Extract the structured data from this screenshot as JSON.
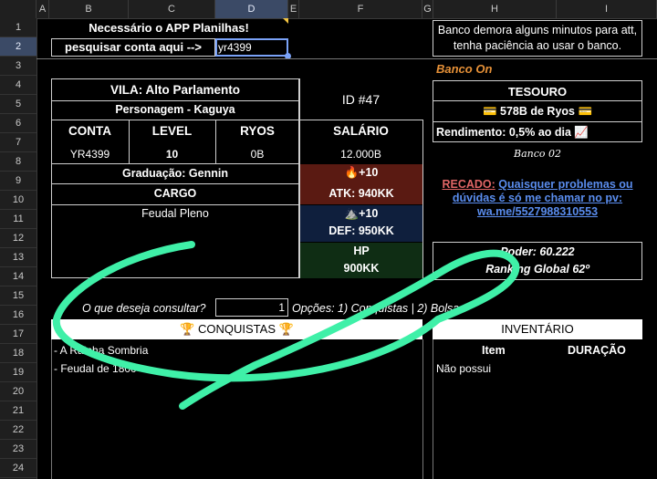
{
  "columns": [
    "A",
    "B",
    "C",
    "D",
    "E",
    "F",
    "G",
    "H",
    "I"
  ],
  "rows": [
    "1",
    "2",
    "3",
    "4",
    "5",
    "6",
    "7",
    "8",
    "9",
    "10",
    "11",
    "12",
    "13",
    "14",
    "15",
    "16",
    "17",
    "18",
    "19",
    "20",
    "21",
    "22",
    "23",
    "24"
  ],
  "header": {
    "app_needed": "Necessário o APP Planilhas!",
    "search_label": "pesquisar conta aqui -->",
    "search_value": "yr4399",
    "bank_note": "Banco demora alguns minutos para att, tenha paciência ao usar o banco."
  },
  "bank": {
    "status": "Banco On",
    "treasury_title": "TESOURO",
    "treasury_value": "💳 578B de Ryos 💳",
    "yield": "Rendimento: 0,5% ao dia 📈",
    "bank_name": "Banco 02",
    "notice_label": "RECADO:",
    "notice_text": "Quaisquer problemas ou dúvidas é só me chamar no pv:",
    "notice_link": "wa.me/5527988310553"
  },
  "profile": {
    "village": "VILA: Alto Parlamento",
    "character": "Personagem - Kaguya",
    "id": "ID #47",
    "col_account": "CONTA",
    "col_level": "LEVEL",
    "col_ryos": "RYOS",
    "col_salary": "SALÁRIO",
    "account": "YR4399",
    "level": "10",
    "ryos": "0B",
    "salary": "12.000B",
    "graduation": "Graduação: Gennin",
    "role_title": "CARGO",
    "role": "Feudal Pleno"
  },
  "stats": {
    "atk_bonus": "🔥+10",
    "atk": "ATK: 940KK",
    "def_bonus": "⛰️+10",
    "def": "DEF: 950KK",
    "hp_title": "HP",
    "hp_value": "900KK"
  },
  "power": {
    "power": "Poder: 60.222",
    "ranking": "Ranking Global 62º"
  },
  "query": {
    "question": "O que deseja consultar?",
    "value": "1",
    "options": "Opções: 1) Conquistas | 2) Bolsa"
  },
  "achievements": {
    "title": "🏆 CONQUISTAS 🏆",
    "items": [
      "- A Rainha Sombria",
      "- Feudal de 1800"
    ]
  },
  "inventory": {
    "title": "INVENTÁRIO",
    "col_item": "Item",
    "col_duration": "DURAÇÃO",
    "empty": "Não possui"
  },
  "colors": {
    "atk_bg": "#5a1a12",
    "def_bg": "#0f1f3d",
    "hp_bg": "#0f2d14",
    "scribble": "#3ff0a8",
    "status_orange": "#e69138",
    "notice_red": "#e06666",
    "link_blue": "#5a8dee"
  }
}
